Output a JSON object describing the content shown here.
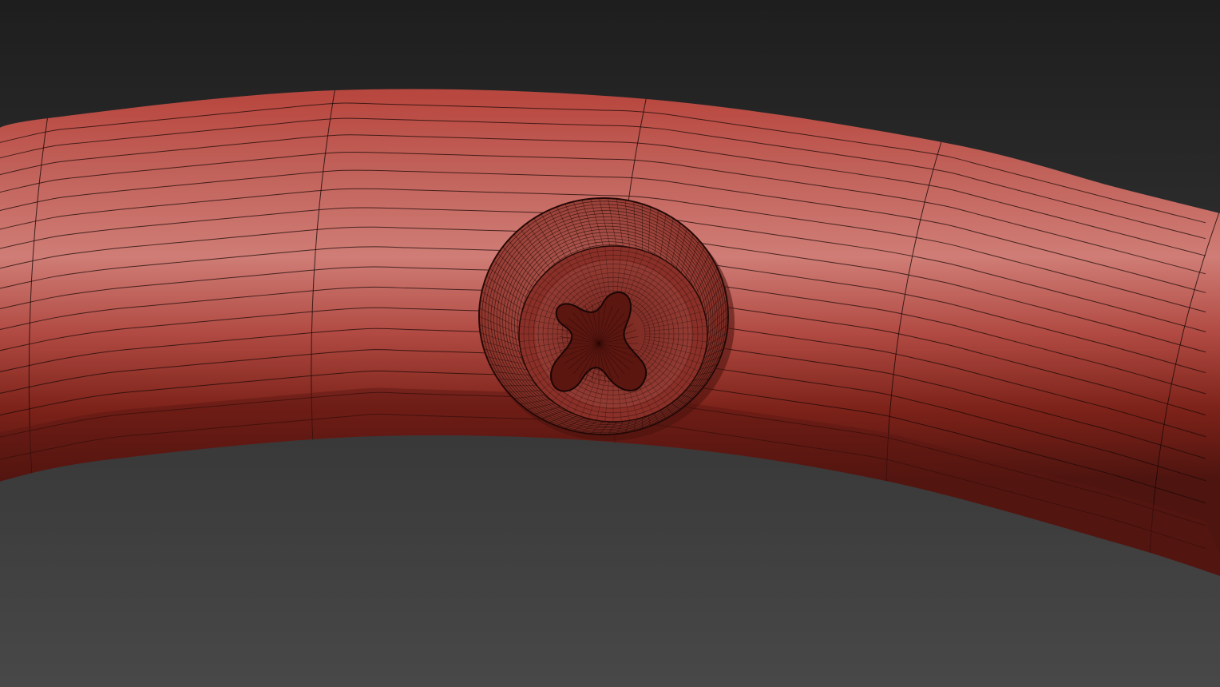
{
  "viewport": {
    "background_top": "#1e1e1e",
    "background_bottom": "#484848",
    "model_color": "#b0453e",
    "model_highlight": "#d58a82",
    "model_shadow": "#5a1712",
    "wire_color": "#1a0806",
    "display_mode": "shaded-with-wireframe"
  },
  "model": {
    "object": "bent-tube",
    "detail": "phillips-screw-head",
    "screw_drive_icon": "phillips-cross-icon"
  }
}
